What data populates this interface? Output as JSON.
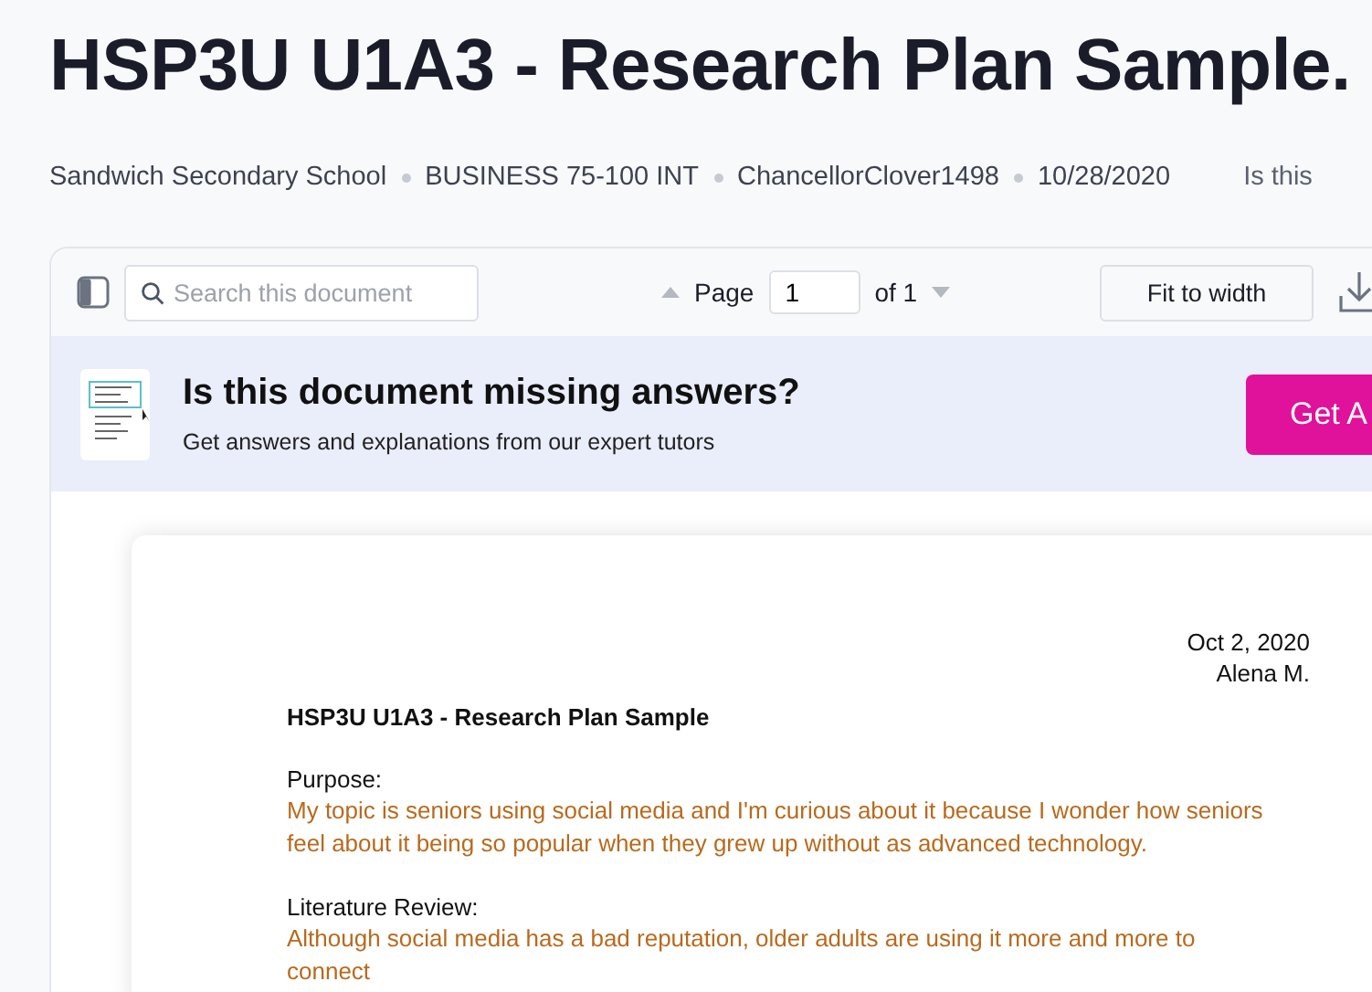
{
  "title": "HSP3U U1A3 - Research Plan Sample.",
  "meta": [
    "Sandwich Secondary School",
    "BUSINESS 75-100 INT",
    "ChancellorClover1498",
    "10/28/2020"
  ],
  "meta_extra": "Is this",
  "toolbar": {
    "search": {
      "placeholder": "Search this document"
    },
    "page_label": "Page",
    "page_value": "1",
    "page_total": "of 1",
    "fit_button": "Fit to width"
  },
  "banner": {
    "heading": "Is this document missing answers?",
    "subtext": "Get answers and explanations from our expert tutors",
    "button": "Get A"
  },
  "document": {
    "date": "Oct 2, 2020",
    "author": "Alena M.",
    "heading": "HSP3U U1A3 - Research Plan Sample",
    "sections": [
      {
        "label": "Purpose:",
        "text": "My topic is seniors using social media and I'm curious about it because I wonder how seniors feel about it being so popular when they grew up without as advanced technology."
      },
      {
        "label": "Literature Review:",
        "text": "Although social media has a bad reputation, older adults are using it more and more to connect"
      }
    ]
  }
}
